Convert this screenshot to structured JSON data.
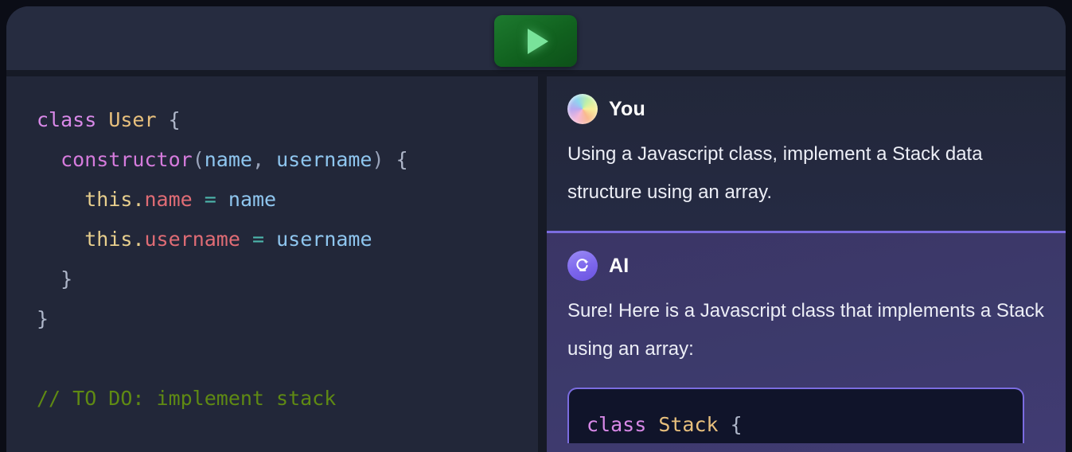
{
  "toolbar": {
    "run_button_label": "Run",
    "run_icon": "play-triangle-icon",
    "accent_green": "#1d7a2f",
    "play_color": "#79e39a"
  },
  "editor": {
    "language": "javascript",
    "code_lines": [
      {
        "text": "class User {",
        "tokens": [
          {
            "t": "class",
            "c": "tok-kw"
          },
          {
            "t": " ",
            "c": ""
          },
          {
            "t": "User",
            "c": "tok-cls"
          },
          {
            "t": " ",
            "c": ""
          },
          {
            "t": "{",
            "c": "tok-brc"
          }
        ]
      },
      {
        "text": "  constructor(name, username) {",
        "tokens": [
          {
            "t": "  ",
            "c": ""
          },
          {
            "t": "constructor",
            "c": "tok-fn"
          },
          {
            "t": "(",
            "c": "tok-par"
          },
          {
            "t": "name",
            "c": "tok-arg"
          },
          {
            "t": ", ",
            "c": "tok-par"
          },
          {
            "t": "username",
            "c": "tok-arg"
          },
          {
            "t": ")",
            "c": "tok-par"
          },
          {
            "t": " ",
            "c": ""
          },
          {
            "t": "{",
            "c": "tok-brc"
          }
        ]
      },
      {
        "text": "    this.name = name",
        "tokens": [
          {
            "t": "    ",
            "c": ""
          },
          {
            "t": "this",
            "c": "tok-this"
          },
          {
            "t": ".",
            "c": "tok-this"
          },
          {
            "t": "name",
            "c": "tok-prop"
          },
          {
            "t": " ",
            "c": ""
          },
          {
            "t": "=",
            "c": "tok-op"
          },
          {
            "t": " ",
            "c": ""
          },
          {
            "t": "name",
            "c": "tok-arg"
          }
        ]
      },
      {
        "text": "    this.username = username",
        "tokens": [
          {
            "t": "    ",
            "c": ""
          },
          {
            "t": "this",
            "c": "tok-this"
          },
          {
            "t": ".",
            "c": "tok-this"
          },
          {
            "t": "username",
            "c": "tok-prop"
          },
          {
            "t": " ",
            "c": ""
          },
          {
            "t": "=",
            "c": "tok-op"
          },
          {
            "t": " ",
            "c": ""
          },
          {
            "t": "username",
            "c": "tok-arg"
          }
        ]
      },
      {
        "text": "  }",
        "tokens": [
          {
            "t": "  ",
            "c": ""
          },
          {
            "t": "}",
            "c": "tok-brc"
          }
        ]
      },
      {
        "text": "}",
        "tokens": [
          {
            "t": "}",
            "c": "tok-brc"
          }
        ]
      },
      {
        "text": "",
        "tokens": []
      },
      {
        "text": "// TO DO: implement stack",
        "tokens": [
          {
            "t": "// TO DO: implement stack",
            "c": "tok-cmt"
          }
        ]
      }
    ]
  },
  "chat": {
    "messages": [
      {
        "author": "You",
        "avatar_icon": "rainbow-orb-avatar-icon",
        "text": "Using a Javascript class, implement a Stack data structure using an array."
      },
      {
        "author": "AI",
        "avatar_icon": "ai-sparkle-avatar-icon",
        "text": "Sure! Here is a Javascript class that implements a Stack using an array:",
        "code_lines": [
          {
            "text": "class Stack {",
            "tokens": [
              {
                "t": "class",
                "c": "tok-kw"
              },
              {
                "t": " ",
                "c": ""
              },
              {
                "t": "Stack",
                "c": "tok-cls"
              },
              {
                "t": " ",
                "c": ""
              },
              {
                "t": "{",
                "c": "tok-brc"
              }
            ]
          }
        ]
      }
    ],
    "divider_color": "#7b6ce0"
  }
}
